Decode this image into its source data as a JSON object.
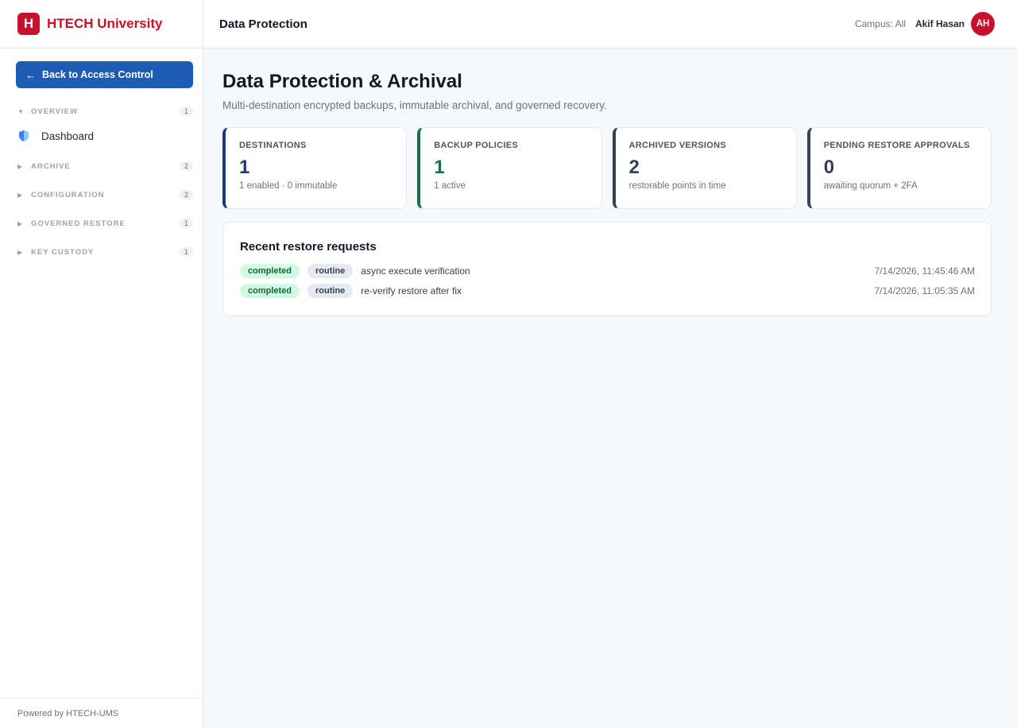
{
  "brand": {
    "logo_letter": "H",
    "name": "HTECH University",
    "color": "#c8102e"
  },
  "sidebar": {
    "back_button": {
      "label": "Back to Access Control",
      "icon": "arrow-left-icon"
    },
    "groups": [
      {
        "label": "OVERVIEW",
        "count": "1",
        "expanded": true
      },
      {
        "label": "ARCHIVE",
        "count": "2",
        "expanded": false
      },
      {
        "label": "CONFIGURATION",
        "count": "2",
        "expanded": false
      },
      {
        "label": "GOVERNED RESTORE",
        "count": "1",
        "expanded": false
      },
      {
        "label": "KEY CUSTODY",
        "count": "1",
        "expanded": false
      }
    ],
    "active_item": {
      "label": "Dashboard",
      "icon": "shield-icon"
    },
    "footer": "Powered by HTECH-UMS"
  },
  "topbar": {
    "page_name": "Data Protection",
    "campus": "Campus: All",
    "user_name": "Akif Hasan",
    "avatar_initials": "AH"
  },
  "main": {
    "title": "Data Protection & Archival",
    "subtitle": "Multi-destination encrypted backups, immutable archival, and governed recovery.",
    "cards": [
      {
        "label": "DESTINATIONS",
        "value": "1",
        "sub": "1 enabled · 0 immutable",
        "accent": "#1f3a6e"
      },
      {
        "label": "BACKUP POLICIES",
        "value": "1",
        "sub": "1 active",
        "accent": "#15704f"
      },
      {
        "label": "ARCHIVED VERSIONS",
        "value": "2",
        "sub": "restorable points in time",
        "accent": "#374151"
      },
      {
        "label": "PENDING RESTORE APPROVALS",
        "value": "0",
        "sub": "awaiting quorum + 2FA",
        "accent": "#374151"
      }
    ],
    "recent": {
      "title": "Recent restore requests",
      "rows": [
        {
          "status": "completed",
          "type": "routine",
          "description": "async execute verification",
          "time": "7/14/2026, 11:45:46 AM"
        },
        {
          "status": "completed",
          "type": "routine",
          "description": "re-verify restore after fix",
          "time": "7/14/2026, 11:05:35 AM"
        }
      ]
    }
  }
}
